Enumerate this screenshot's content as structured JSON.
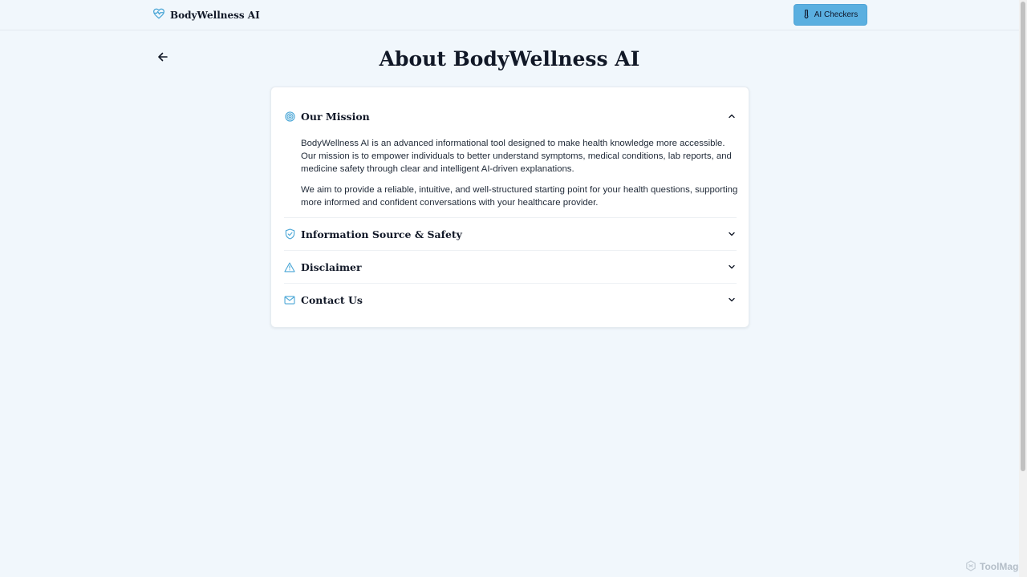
{
  "header": {
    "brand_name": "BodyWellness AI",
    "ai_checkers_label": "AI Checkers"
  },
  "page": {
    "title": "About BodyWellness AI"
  },
  "sections": [
    {
      "title": "Our Mission",
      "icon": "target-icon",
      "expanded": true,
      "paragraphs": [
        "BodyWellness AI is an advanced informational tool designed to make health knowledge more accessible. Our mission is to empower individuals to better understand symptoms, medical conditions, lab reports, and medicine safety through clear and intelligent AI-driven explanations.",
        "We aim to provide a reliable, intuitive, and well-structured starting point for your health questions, supporting more informed and confident conversations with your healthcare provider."
      ]
    },
    {
      "title": "Information Source & Safety",
      "icon": "shield-check-icon",
      "expanded": false
    },
    {
      "title": "Disclaimer",
      "icon": "warning-triangle-icon",
      "expanded": false
    },
    {
      "title": "Contact Us",
      "icon": "mail-icon",
      "expanded": false
    }
  ],
  "watermark": {
    "text": "ToolMage"
  },
  "colors": {
    "accent": "#5aafe0",
    "icon": "#4aa6d6",
    "background": "#f1f7fc"
  }
}
